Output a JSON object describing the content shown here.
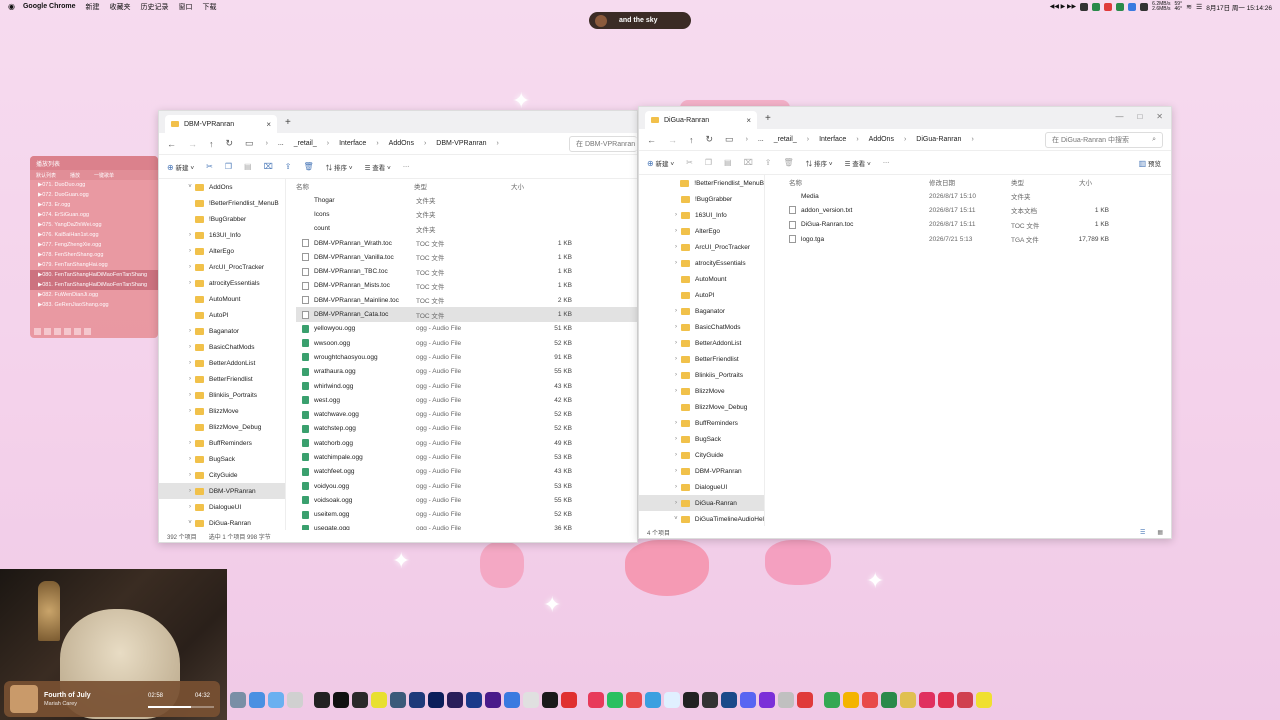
{
  "menubar": {
    "app_name": "Google Chrome",
    "items": [
      "新建",
      "收藏夹",
      "历史记录",
      "窗口",
      "下载"
    ],
    "net_up": "6.2MB/s",
    "net_down": "2.6MB/s",
    "temp1": "59°",
    "temp2": "46°",
    "datetime": "8月17日 周一 15:14:26"
  },
  "island": {
    "title": "and the sky"
  },
  "left_window": {
    "tab_title": "DBM-VPRanran",
    "breadcrumb": [
      "...",
      "_retail_",
      "Interface",
      "AddOns",
      "DBM-VPRanran"
    ],
    "search_placeholder": "在 DBM-VPRanran 中",
    "toolbar": {
      "new": "新建",
      "sort": "排序",
      "view": "查看"
    },
    "tree": [
      {
        "label": "AddOns",
        "depth": 0,
        "chev": "v"
      },
      {
        "label": "!BetterFriendlist_MenuB",
        "depth": 1
      },
      {
        "label": "!BugGrabber",
        "depth": 1
      },
      {
        "label": "163UI_Info",
        "depth": 1,
        "chev": ">"
      },
      {
        "label": "AlterEgo",
        "depth": 1,
        "chev": ">"
      },
      {
        "label": "ArcUI_ProcTracker",
        "depth": 1,
        "chev": ">"
      },
      {
        "label": "atrocityEssentials",
        "depth": 1,
        "chev": ">"
      },
      {
        "label": "AutoMount",
        "depth": 1
      },
      {
        "label": "AutoPI",
        "depth": 1
      },
      {
        "label": "Baganator",
        "depth": 1,
        "chev": ">"
      },
      {
        "label": "BasicChatMods",
        "depth": 1,
        "chev": ">"
      },
      {
        "label": "BetterAddonList",
        "depth": 1,
        "chev": ">"
      },
      {
        "label": "BetterFriendlist",
        "depth": 1,
        "chev": ">"
      },
      {
        "label": "Blinkiis_Portraits",
        "depth": 1,
        "chev": ">"
      },
      {
        "label": "BlizzMove",
        "depth": 1,
        "chev": ">"
      },
      {
        "label": "BlizzMove_Debug",
        "depth": 1
      },
      {
        "label": "BuffReminders",
        "depth": 1,
        "chev": ">"
      },
      {
        "label": "BugSack",
        "depth": 1,
        "chev": ">"
      },
      {
        "label": "CityGuide",
        "depth": 1,
        "chev": ">"
      },
      {
        "label": "DBM-VPRanran",
        "depth": 1,
        "chev": ">",
        "selected": true
      },
      {
        "label": "DialogueUI",
        "depth": 1,
        "chev": ">"
      },
      {
        "label": "DiGua-Ranran",
        "depth": 1,
        "chev": "v"
      }
    ],
    "columns": [
      "名称",
      "类型",
      "大小"
    ],
    "files": [
      {
        "name": "Thogar",
        "type": "文件夹",
        "size": "",
        "kind": "folder"
      },
      {
        "name": "Icons",
        "type": "文件夹",
        "size": "",
        "kind": "folder"
      },
      {
        "name": "count",
        "type": "文件夹",
        "size": "",
        "kind": "folder"
      },
      {
        "name": "DBM-VPRanran_Wrath.toc",
        "type": "TOC 文件",
        "size": "1 KB",
        "kind": "file"
      },
      {
        "name": "DBM-VPRanran_Vanilla.toc",
        "type": "TOC 文件",
        "size": "1 KB",
        "kind": "file"
      },
      {
        "name": "DBM-VPRanran_TBC.toc",
        "type": "TOC 文件",
        "size": "1 KB",
        "kind": "file"
      },
      {
        "name": "DBM-VPRanran_Mists.toc",
        "type": "TOC 文件",
        "size": "1 KB",
        "kind": "file"
      },
      {
        "name": "DBM-VPRanran_Mainline.toc",
        "type": "TOC 文件",
        "size": "2 KB",
        "kind": "file"
      },
      {
        "name": "DBM-VPRanran_Cata.toc",
        "type": "TOC 文件",
        "size": "1 KB",
        "kind": "file",
        "selected": true
      },
      {
        "name": "yellowyou.ogg",
        "type": "ogg - Audio File",
        "size": "51 KB",
        "kind": "audio"
      },
      {
        "name": "wwsoon.ogg",
        "type": "ogg - Audio File",
        "size": "52 KB",
        "kind": "audio"
      },
      {
        "name": "wroughtchaosyou.ogg",
        "type": "ogg - Audio File",
        "size": "91 KB",
        "kind": "audio"
      },
      {
        "name": "wrathaura.ogg",
        "type": "ogg - Audio File",
        "size": "55 KB",
        "kind": "audio"
      },
      {
        "name": "whirlwind.ogg",
        "type": "ogg - Audio File",
        "size": "43 KB",
        "kind": "audio"
      },
      {
        "name": "west.ogg",
        "type": "ogg - Audio File",
        "size": "42 KB",
        "kind": "audio"
      },
      {
        "name": "watchwave.ogg",
        "type": "ogg - Audio File",
        "size": "52 KB",
        "kind": "audio"
      },
      {
        "name": "watchstep.ogg",
        "type": "ogg - Audio File",
        "size": "52 KB",
        "kind": "audio"
      },
      {
        "name": "watchorb.ogg",
        "type": "ogg - Audio File",
        "size": "49 KB",
        "kind": "audio"
      },
      {
        "name": "watchimpale.ogg",
        "type": "ogg - Audio File",
        "size": "53 KB",
        "kind": "audio"
      },
      {
        "name": "watchfeet.ogg",
        "type": "ogg - Audio File",
        "size": "43 KB",
        "kind": "audio"
      },
      {
        "name": "voidyou.ogg",
        "type": "ogg - Audio File",
        "size": "53 KB",
        "kind": "audio"
      },
      {
        "name": "voidsoak.ogg",
        "type": "ogg - Audio File",
        "size": "55 KB",
        "kind": "audio"
      },
      {
        "name": "useitem.ogg",
        "type": "ogg - Audio File",
        "size": "52 KB",
        "kind": "audio"
      },
      {
        "name": "useqate.ogg",
        "type": "ogg - Audio File",
        "size": "36 KB",
        "kind": "audio"
      }
    ],
    "status_count": "392 个项目",
    "status_selected": "选中 1 个项目  998 字节"
  },
  "right_window": {
    "tab_title": "DiGua-Ranran",
    "breadcrumb": [
      "...",
      "_retail_",
      "Interface",
      "AddOns",
      "DiGua-Ranran"
    ],
    "search_placeholder": "在 DiGua-Ranran 中搜索",
    "toolbar": {
      "new": "新建",
      "sort": "排序",
      "view": "查看",
      "preview": "预览"
    },
    "tree": [
      {
        "label": "!BetterFriendlist_MenuB",
        "chev": ""
      },
      {
        "label": "!BugGrabber",
        "chev": ""
      },
      {
        "label": "163UI_Info",
        "chev": ">"
      },
      {
        "label": "AlterEgo",
        "chev": ">"
      },
      {
        "label": "ArcUI_ProcTracker",
        "chev": ">"
      },
      {
        "label": "atrocityEssentials",
        "chev": ">"
      },
      {
        "label": "AutoMount",
        "chev": ""
      },
      {
        "label": "AutoPI",
        "chev": ""
      },
      {
        "label": "Baganator",
        "chev": ">"
      },
      {
        "label": "BasicChatMods",
        "chev": ">"
      },
      {
        "label": "BetterAddonList",
        "chev": ">"
      },
      {
        "label": "BetterFriendlist",
        "chev": ">"
      },
      {
        "label": "Blinkiis_Portraits",
        "chev": ">"
      },
      {
        "label": "BlizzMove",
        "chev": ">"
      },
      {
        "label": "BlizzMove_Debug",
        "chev": ""
      },
      {
        "label": "BuffReminders",
        "chev": ">"
      },
      {
        "label": "BugSack",
        "chev": ">"
      },
      {
        "label": "CityGuide",
        "chev": ">"
      },
      {
        "label": "DBM-VPRanran",
        "chev": ">"
      },
      {
        "label": "DialogueUI",
        "chev": ">"
      },
      {
        "label": "DiGua-Ranran",
        "chev": ">",
        "selected": true
      },
      {
        "label": "DiGuaTimelineAudioHel",
        "chev": "v"
      }
    ],
    "columns": [
      "名称",
      "修改日期",
      "类型",
      "大小"
    ],
    "files": [
      {
        "name": "Media",
        "date": "2026/8/17 15:10",
        "type": "文件夹",
        "size": "",
        "kind": "folder"
      },
      {
        "name": "addon_version.txt",
        "date": "2026/8/17 15:11",
        "type": "文本文档",
        "size": "1 KB",
        "kind": "file"
      },
      {
        "name": "DiGua-Ranran.toc",
        "date": "2026/8/17 15:11",
        "type": "TOC 文件",
        "size": "1 KB",
        "kind": "file"
      },
      {
        "name": "logo.tga",
        "date": "2026/7/21 5:13",
        "type": "TGA 文件",
        "size": "17,789 KB",
        "kind": "file"
      }
    ],
    "status_count": "4 个项目"
  },
  "playlist": {
    "title": "播放列表",
    "tabs": [
      "默认列表",
      "播放",
      "一键歌单"
    ],
    "items": [
      "071. DuoDuo.ogg",
      "072. DuoGuan.ogg",
      "073. Er.ogg",
      "074. ErSiGuan.ogg",
      "075. YangDaZhiWei.ogg",
      "076. KaiBaiHan1st.ogg",
      "077. FengZhengXie.ogg",
      "078. FenShenShang.ogg",
      "079. FenTanShangHai.ogg",
      "080. FenTanShangHaiDiMaoFenTanShang",
      "081. FenTanShangHaiDiMaoFenTanShang",
      "082. FuWenDianJi.ogg",
      "083. GeRenJiaoShang.ogg"
    ]
  },
  "now_playing": {
    "title": "Fourth of July",
    "artist": "Mariah Carey",
    "elapsed": "02:58",
    "total": "04:32",
    "progress": 0.65
  },
  "dock_colors": [
    "#7a8fa6",
    "#4a90e2",
    "#6ab0f0",
    "#d0d0d0",
    "#222",
    "#111",
    "#2a2a2a",
    "#e8e030",
    "#3c5a7a",
    "#1e3a7a",
    "#0b1e5a",
    "#2a1e5a",
    "#1a3a8a",
    "#4a1a8a",
    "#3a7ae0",
    "#e0e0e0",
    "#1a1a1a",
    "#e03030",
    "#e83a5a",
    "#2ac060",
    "#e84a4a",
    "#3aa0e0",
    "#e0f0ff",
    "#222",
    "#333",
    "#1a4a8a",
    "#5865f2",
    "#7b2fd8",
    "#c0c0c0",
    "#e03a3a",
    "#34a853",
    "#f4b400",
    "#e84a4a",
    "#2a8a4a",
    "#e0c050",
    "#e03060",
    "#e03050",
    "#d04050",
    "#f0e030"
  ]
}
